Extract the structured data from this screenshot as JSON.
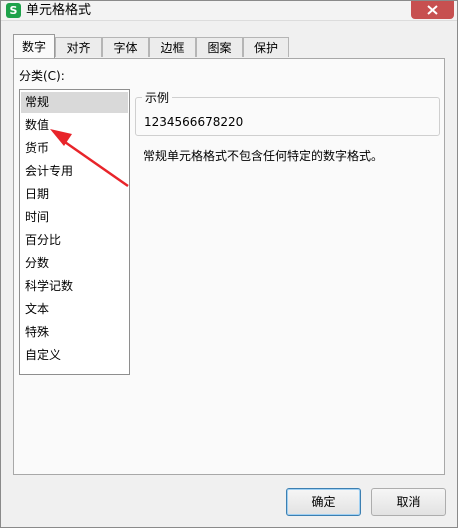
{
  "window": {
    "title": "单元格格式",
    "app_icon": "S"
  },
  "tabs": [
    "数字",
    "对齐",
    "字体",
    "边框",
    "图案",
    "保护"
  ],
  "category": {
    "label": "分类(C):",
    "items": [
      "常规",
      "数值",
      "货币",
      "会计专用",
      "日期",
      "时间",
      "百分比",
      "分数",
      "科学记数",
      "文本",
      "特殊",
      "自定义"
    ],
    "selected": "常规"
  },
  "sample": {
    "title": "示例",
    "value": "1234566678220"
  },
  "description": "常规单元格格式不包含任何特定的数字格式。",
  "buttons": {
    "ok": "确定",
    "cancel": "取消"
  },
  "colors": {
    "annotation_arrow": "#e8242a",
    "app_icon": "#1ea24a",
    "close": "#c75050"
  }
}
